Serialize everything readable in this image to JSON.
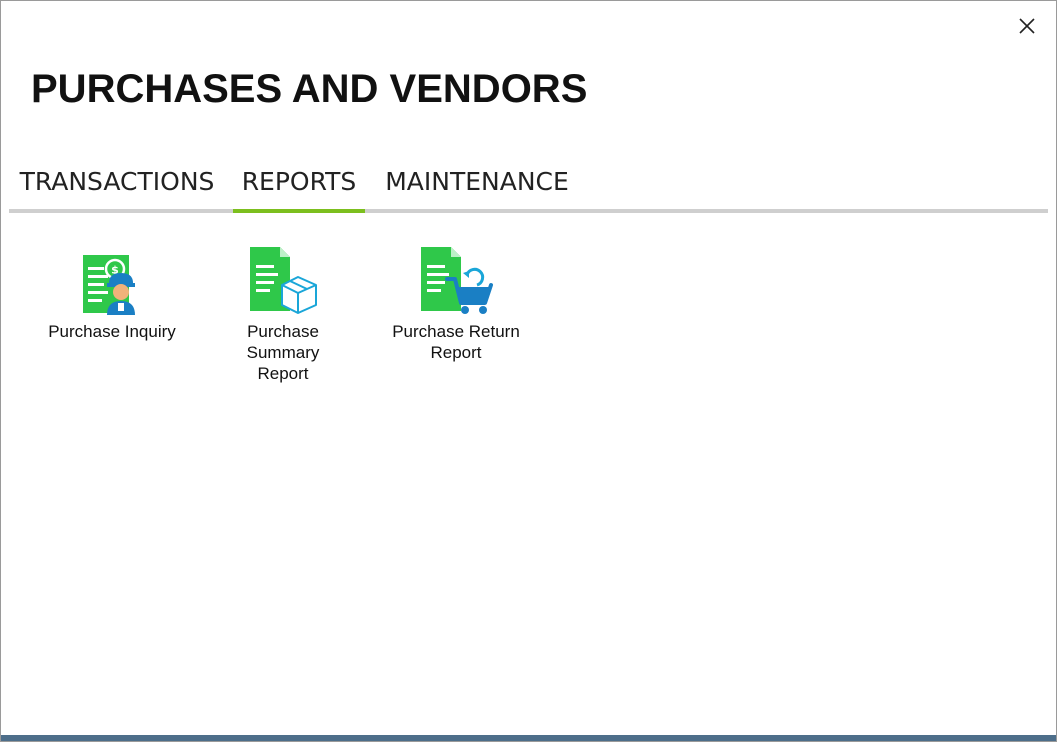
{
  "window": {
    "title": "PURCHASES AND VENDORS"
  },
  "tabs": [
    {
      "label": "TRANSACTIONS",
      "active": false
    },
    {
      "label": "REPORTS",
      "active": true
    },
    {
      "label": "MAINTENANCE",
      "active": false
    }
  ],
  "tiles": [
    {
      "label_line1": "Purchase Inquiry",
      "label_line2": "",
      "icon": "purchase-inquiry-icon"
    },
    {
      "label_line1": "Purchase Summary",
      "label_line2": "Report",
      "icon": "purchase-summary-report-icon"
    },
    {
      "label_line1": "Purchase Return",
      "label_line2": "Report",
      "icon": "purchase-return-report-icon"
    }
  ],
  "colors": {
    "accent": "#7cbf1e",
    "icon_green": "#2fc84a",
    "icon_blue": "#1aa6d8",
    "bottom_bar": "#4d6e8a"
  }
}
